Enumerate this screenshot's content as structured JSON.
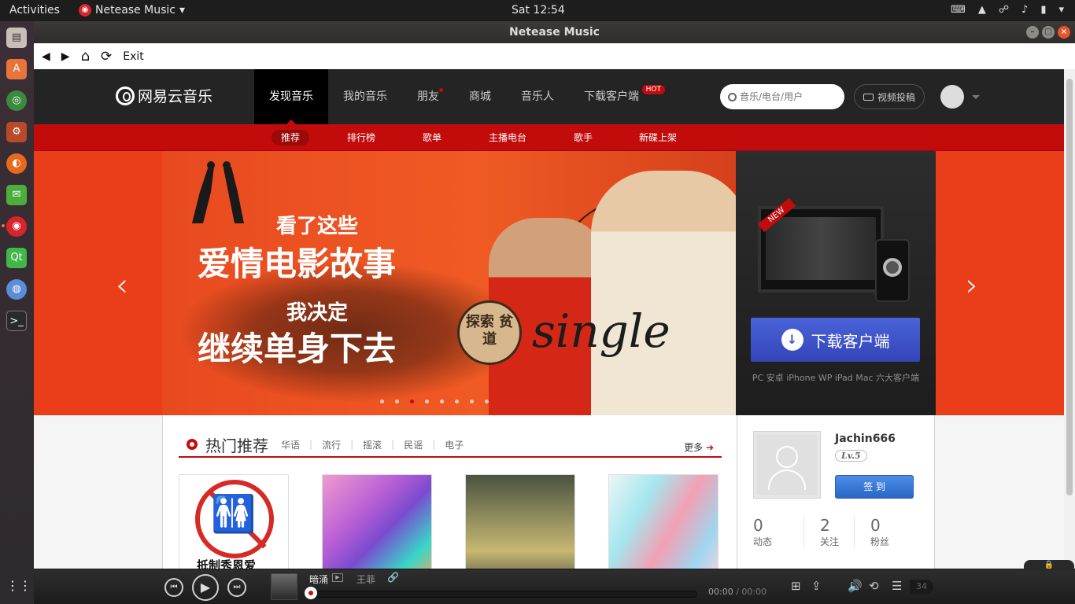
{
  "system": {
    "activities": "Activities",
    "app_name": "Netease Music",
    "clock": "Sat 12:54"
  },
  "window": {
    "title": "Netease Music"
  },
  "app_toolbar": {
    "back": "◀",
    "forward": "▶",
    "home": "⌂",
    "reload": "⟳",
    "exit": "Exit"
  },
  "header": {
    "logo": "网易云音乐",
    "nav": [
      "发现音乐",
      "我的音乐",
      "朋友",
      "商城",
      "音乐人",
      "下载客户端"
    ],
    "hot_badge": "HOT",
    "search_placeholder": "音乐/电台/用户",
    "video_upload": "视频投稿"
  },
  "subnav": [
    "推荐",
    "排行榜",
    "歌单",
    "主播电台",
    "歌手",
    "新碟上架"
  ],
  "banner": {
    "line1": "看了这些",
    "line2": "爱情电影故事",
    "line3": "我决定",
    "line4": "继续单身下去",
    "stamp": "探索 贫道",
    "script": "single",
    "slide_count": 8,
    "active_slide": 3,
    "download_button": "下载客户端",
    "download_sub": "PC 安卓 iPhone WP iPad Mac 六大客户端",
    "new_tag": "NEW",
    "prev_arrow": "‹",
    "next_arrow": "›"
  },
  "hot": {
    "title": "热门推荐",
    "tags": [
      "华语",
      "流行",
      "摇滚",
      "民谣",
      "电子"
    ],
    "more": "更多",
    "first_card_caption": "抵制秀恩爱"
  },
  "user": {
    "name": "Jachin666",
    "level": "Lv.5",
    "sign_button": "签 到",
    "stats": [
      {
        "value": "0",
        "label": "动态"
      },
      {
        "value": "2",
        "label": "关注"
      },
      {
        "value": "0",
        "label": "粉丝"
      }
    ]
  },
  "player": {
    "song": "暗涌",
    "artist": "王菲",
    "time_current": "00:00",
    "time_sep": " / ",
    "time_total": "00:00",
    "playlist_count": "34",
    "progress": 0
  },
  "colors": {
    "brand_red": "#c20c0c",
    "header_bg": "#242424",
    "download_blue": "#3a54c9"
  }
}
